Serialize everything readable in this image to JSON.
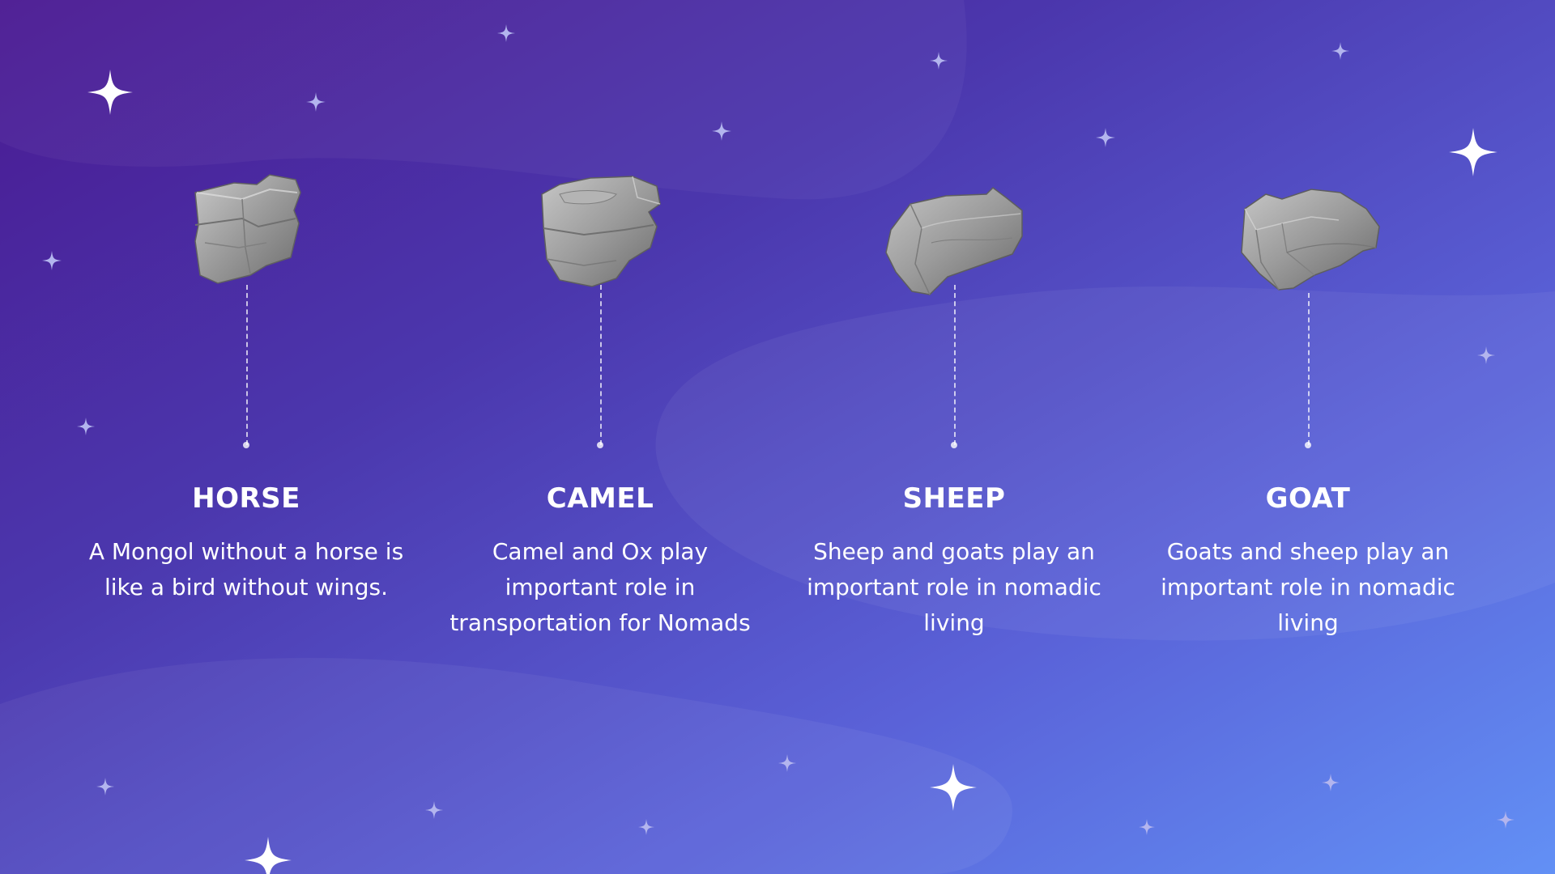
{
  "cards": [
    {
      "title": "HORSE",
      "text": "A Mongol without a horse is like a bird without wings."
    },
    {
      "title": "CAMEL",
      "text": "Camel and Ox play important role in transportation for Nomads"
    },
    {
      "title": "SHEEP",
      "text": "Sheep and goats play an important role in nomadic living"
    },
    {
      "title": "GOAT",
      "text": "Goats and sheep play an important role in nomadic living"
    }
  ],
  "colors": {
    "background_start": "#4a1a92",
    "background_end": "#6290f5",
    "text": "#ffffff",
    "star_bright": "#ffffff",
    "star_dim": "#b3b5ee",
    "rock": "#9a9a9a"
  },
  "icons": {
    "decoration": "sparkle-star-icon",
    "card_image": "stone-rock-icon"
  }
}
